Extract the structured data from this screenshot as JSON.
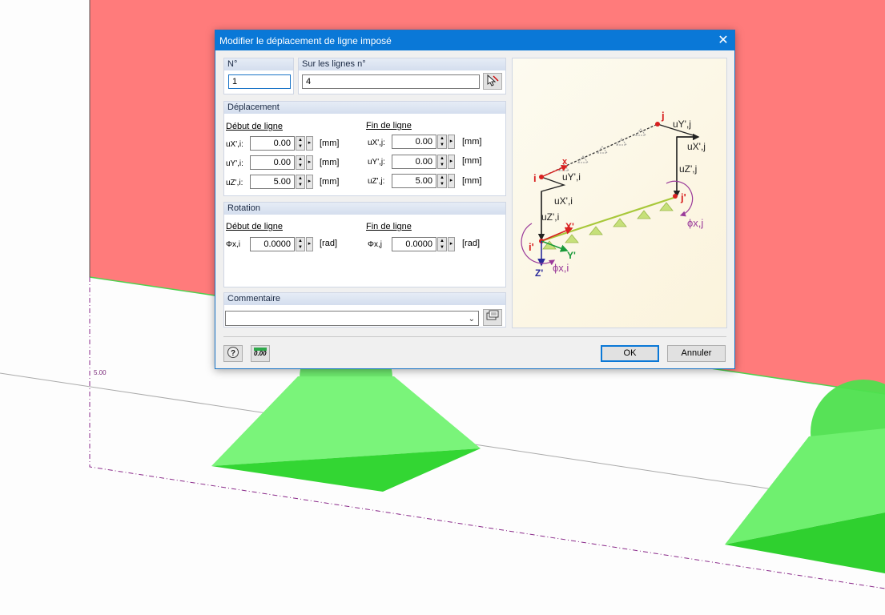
{
  "dialog": {
    "title": "Modifier le déplacement de ligne imposé",
    "close_glyph": "✕"
  },
  "numero": {
    "label": "N°",
    "value": "1"
  },
  "lignes": {
    "label": "Sur les lignes n°",
    "value": "4",
    "pick_icon": "select-lines-icon"
  },
  "deplacement": {
    "header": "Déplacement",
    "start_label": "Début de ligne",
    "end_label": "Fin de ligne",
    "start": [
      {
        "sym": "uX',i:",
        "value": "0.00",
        "unit": "[mm]"
      },
      {
        "sym": "uY',i:",
        "value": "0.00",
        "unit": "[mm]"
      },
      {
        "sym": "uZ',i:",
        "value": "5.00",
        "unit": "[mm]"
      }
    ],
    "end": [
      {
        "sym": "uX',j:",
        "value": "0.00",
        "unit": "[mm]"
      },
      {
        "sym": "uY',j:",
        "value": "0.00",
        "unit": "[mm]"
      },
      {
        "sym": "uZ',j:",
        "value": "5.00",
        "unit": "[mm]"
      }
    ]
  },
  "rotation": {
    "header": "Rotation",
    "start_label": "Début de ligne",
    "end_label": "Fin de ligne",
    "start": {
      "sym": "Φx,i",
      "value": "0.0000",
      "unit": "[rad]"
    },
    "end": {
      "sym": "Φx,j",
      "value": "0.0000",
      "unit": "[rad]"
    }
  },
  "commentaire": {
    "header": "Commentaire",
    "value": ""
  },
  "diagram": {
    "labels": {
      "i": "i",
      "j": "j",
      "ip": "i'",
      "jp": "j'",
      "x": "x",
      "Xp": "X'",
      "Yp": "Y'",
      "Zp": "Z'",
      "uYj": "uY',j",
      "uXj": "uX',j",
      "uZj": "uZ',j",
      "uYi": "uY',i",
      "uXi": "uX',i",
      "uZi": "uZ',i",
      "phij": "ϕx,j",
      "phii": "ϕx,i"
    }
  },
  "footer": {
    "help_icon": "help-icon",
    "units_icon": "units-icon",
    "units_text": "0.00",
    "ok": "OK",
    "cancel": "Annuler"
  },
  "scene": {
    "dim_label": "5.00"
  },
  "colors": {
    "accent": "#0a78d7",
    "surface": "#ff7b7b",
    "support": "#3ee83e"
  }
}
